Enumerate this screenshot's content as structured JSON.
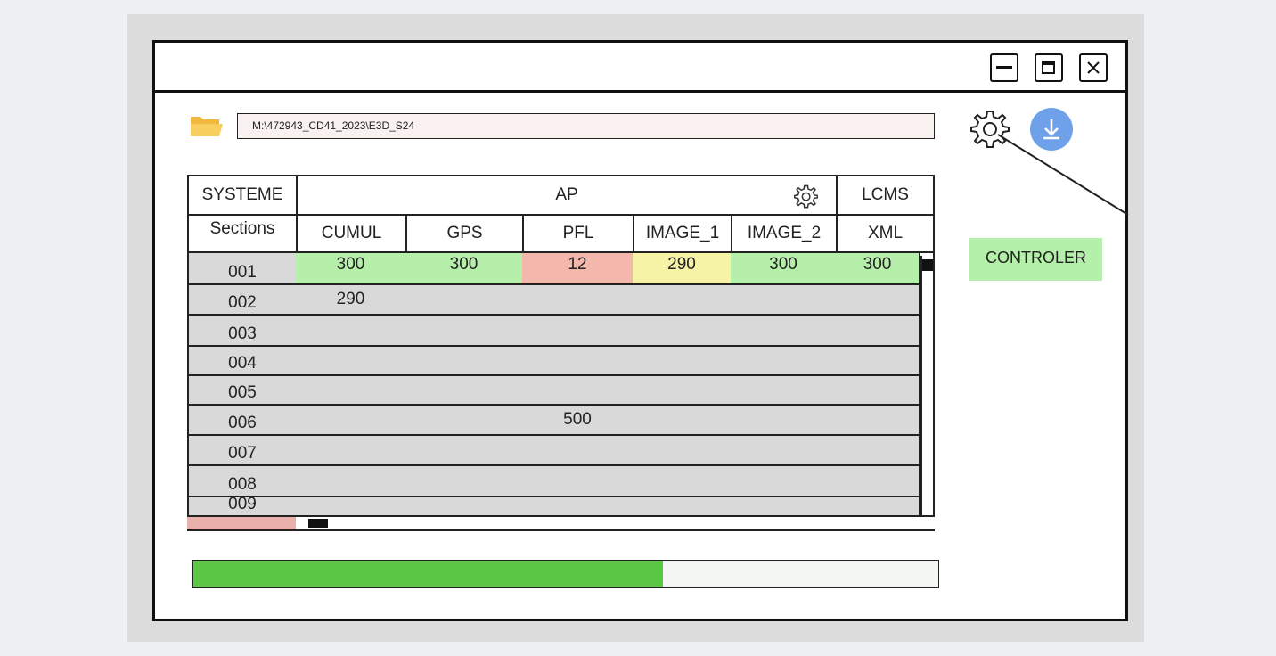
{
  "window": {
    "controls": [
      "minimize",
      "maximize",
      "close"
    ]
  },
  "toolbar": {
    "path": "M:\\472943_CD41_2023\\E3D_S24",
    "icons": [
      "folder-icon",
      "gear-icon",
      "download-icon"
    ],
    "controler_label": "CONTROLER"
  },
  "table": {
    "group_headers": {
      "systeme": "SYSTEME",
      "ap": "AP",
      "lcms": "LCMS"
    },
    "columns": [
      "Sections",
      "CUMUL",
      "GPS",
      "PFL",
      "IMAGE_1",
      "IMAGE_2",
      "XML"
    ],
    "rows": [
      {
        "section": "001",
        "values": [
          "300",
          "300",
          "12",
          "290",
          "300",
          "300"
        ],
        "status": [
          "green",
          "green",
          "red",
          "yellow",
          "green",
          "green"
        ]
      },
      {
        "section": "002",
        "values": [
          "290",
          "",
          "",
          "",
          "",
          ""
        ],
        "status": [
          "",
          "",
          "",
          "",
          "",
          ""
        ]
      },
      {
        "section": "003",
        "values": [
          "",
          "",
          "",
          "",
          "",
          ""
        ],
        "status": [
          "",
          "",
          "",
          "",
          "",
          ""
        ]
      },
      {
        "section": "004",
        "values": [
          "",
          "",
          "",
          "",
          "",
          ""
        ],
        "status": [
          "",
          "",
          "",
          "",
          "",
          ""
        ]
      },
      {
        "section": "005",
        "values": [
          "",
          "",
          "",
          "",
          "",
          ""
        ],
        "status": [
          "",
          "",
          "",
          "",
          "",
          ""
        ]
      },
      {
        "section": "006",
        "values": [
          "",
          "",
          "500",
          "",
          "",
          ""
        ],
        "status": [
          "",
          "",
          "",
          "",
          "",
          ""
        ]
      },
      {
        "section": "007",
        "values": [
          "",
          "",
          "",
          "",
          "",
          ""
        ],
        "status": [
          "",
          "",
          "",
          "",
          "",
          ""
        ]
      },
      {
        "section": "008",
        "values": [
          "",
          "",
          "",
          "",
          "",
          ""
        ],
        "status": [
          "",
          "",
          "",
          "",
          "",
          ""
        ]
      },
      {
        "section": "009",
        "values": [
          "",
          "",
          "",
          "",
          "",
          ""
        ],
        "status": [
          "",
          "",
          "",
          "",
          "",
          ""
        ]
      }
    ]
  },
  "progress": {
    "fraction": 0.63
  },
  "colors": {
    "ok": "#b6efaa",
    "error": "#f3b8ab",
    "warning": "#f6f2a6",
    "progress": "#5cc745",
    "download": "#6ea1ea"
  }
}
